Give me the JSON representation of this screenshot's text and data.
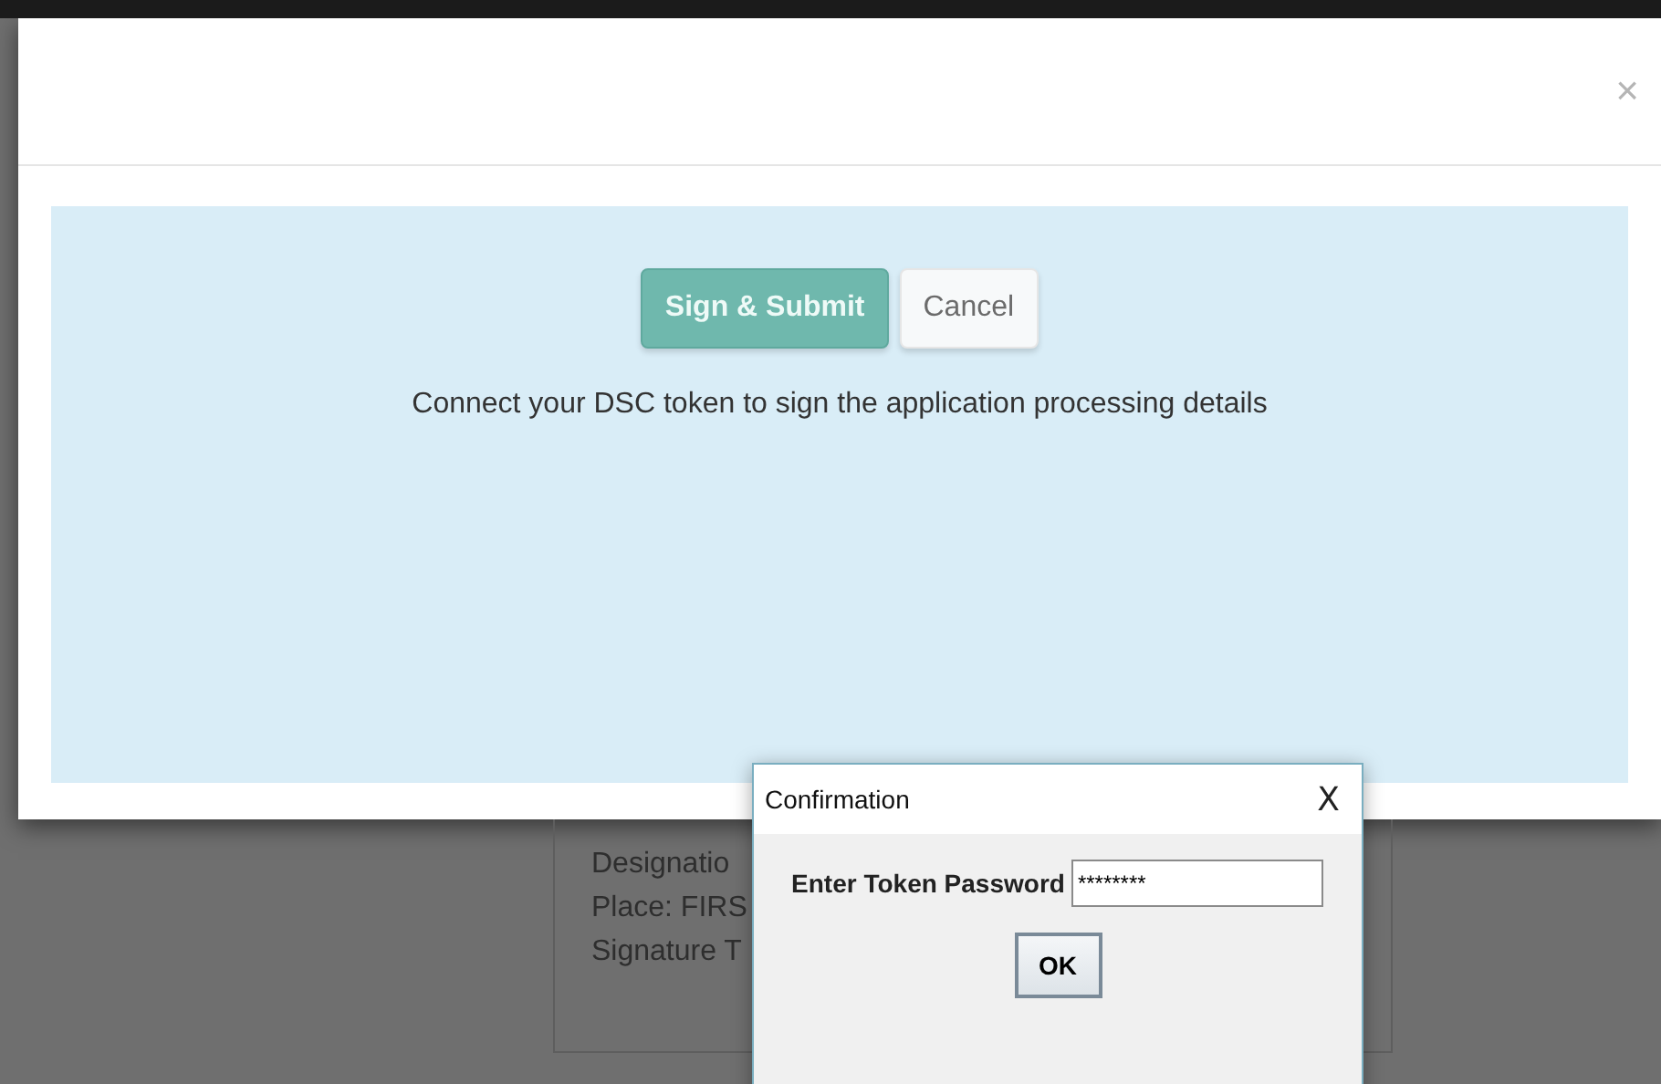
{
  "modal": {
    "close": "×",
    "actions": [
      {
        "label": "Sign & Submit",
        "kind": "primary"
      },
      {
        "label": "Cancel",
        "kind": "default"
      }
    ],
    "message": "Connect your DSC token to sign the application processing details"
  },
  "background_card": {
    "lines": [
      "Designatio",
      "Place: FIRS",
      "Signature T"
    ]
  },
  "dialog": {
    "title": "Confirmation",
    "close": "X",
    "label": "Enter Token Password",
    "value": "********",
    "button": "OK"
  }
}
